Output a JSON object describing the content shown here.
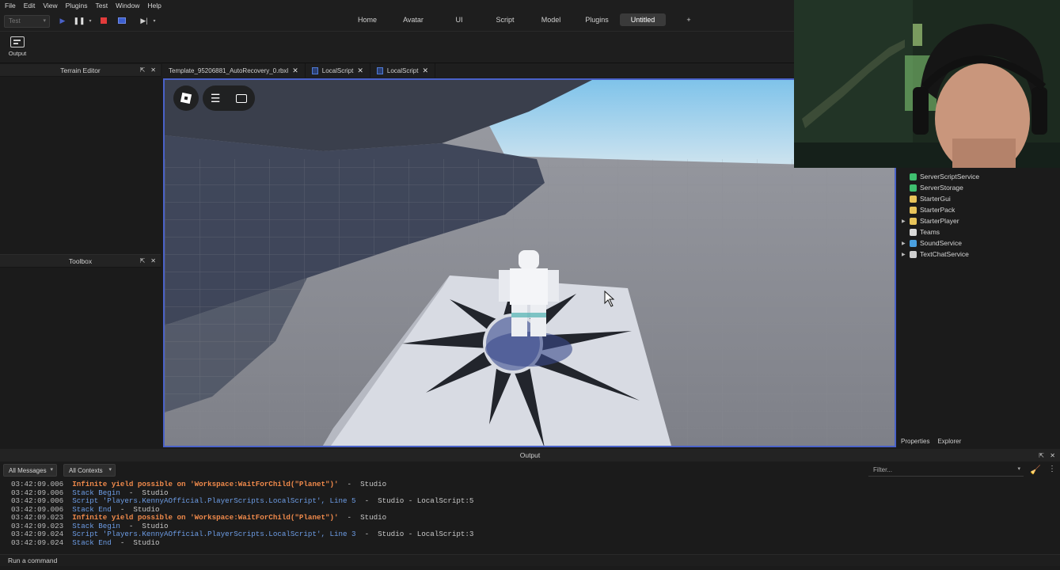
{
  "menu": [
    "File",
    "Edit",
    "View",
    "Plugins",
    "Test",
    "Window",
    "Help"
  ],
  "toolbar": {
    "mode_value": "Test"
  },
  "ribbon_tabs": [
    {
      "label": "Home"
    },
    {
      "label": "Avatar"
    },
    {
      "label": "UI"
    },
    {
      "label": "Script"
    },
    {
      "label": "Model"
    },
    {
      "label": "Plugins"
    },
    {
      "label": "Untitled",
      "active": true
    },
    {
      "label": "+"
    }
  ],
  "ribbon": {
    "output_label": "Output"
  },
  "panels": {
    "terrain_editor": "Terrain Editor",
    "toolbox": "Toolbox"
  },
  "doc_tabs": [
    {
      "label": "Template_95206881_AutoRecovery_0.rbxl"
    },
    {
      "label": "LocalScript"
    },
    {
      "label": "LocalScript"
    }
  ],
  "explorer": {
    "items": [
      {
        "label": "ServerScriptService",
        "icon": "server-script-icon",
        "color": "#3fbf6f",
        "expandable": false
      },
      {
        "label": "ServerStorage",
        "icon": "server-storage-icon",
        "color": "#3fbf6f",
        "expandable": false
      },
      {
        "label": "StarterGui",
        "icon": "folder-icon",
        "color": "#e8c45a",
        "expandable": false
      },
      {
        "label": "StarterPack",
        "icon": "folder-icon",
        "color": "#e8c45a",
        "expandable": false
      },
      {
        "label": "StarterPlayer",
        "icon": "folder-icon",
        "color": "#e8c45a",
        "expandable": true
      },
      {
        "label": "Teams",
        "icon": "teams-icon",
        "color": "#d9d9d9",
        "expandable": false
      },
      {
        "label": "SoundService",
        "icon": "sound-icon",
        "color": "#4aa0e0",
        "expandable": true
      },
      {
        "label": "TextChatService",
        "icon": "chat-icon",
        "color": "#cfcfcf",
        "expandable": true
      }
    ],
    "bottom_tabs": [
      "Properties",
      "Explorer"
    ]
  },
  "output": {
    "title": "Output",
    "messages_filter": "All Messages",
    "contexts_filter": "All Contexts",
    "filter_placeholder": "Filter...",
    "lines": [
      {
        "time": "03:42:09.006",
        "kind": "warn",
        "text": "Infinite yield possible on 'Workspace:WaitForChild(\"Planet\")'",
        "suffix": "  -  Studio"
      },
      {
        "time": "03:42:09.006",
        "kind": "info",
        "text": "Stack Begin",
        "suffix": "  -  Studio"
      },
      {
        "time": "03:42:09.006",
        "kind": "info",
        "text": "Script 'Players.KennyAOfficial.PlayerScripts.LocalScript', Line 5",
        "suffix": "  -  Studio - LocalScript:5"
      },
      {
        "time": "03:42:09.006",
        "kind": "info",
        "text": "Stack End",
        "suffix": "  -  Studio"
      },
      {
        "time": "03:42:09.023",
        "kind": "warn",
        "text": "Infinite yield possible on 'Workspace:WaitForChild(\"Planet\")'",
        "suffix": "  -  Studio"
      },
      {
        "time": "03:42:09.023",
        "kind": "info",
        "text": "Stack Begin",
        "suffix": "  -  Studio"
      },
      {
        "time": "03:42:09.024",
        "kind": "info",
        "text": "Script 'Players.KennyAOfficial.PlayerScripts.LocalScript', Line 3",
        "suffix": "  -  Studio - LocalScript:3"
      },
      {
        "time": "03:42:09.024",
        "kind": "info",
        "text": "Stack End",
        "suffix": "  -  Studio"
      }
    ],
    "command_placeholder": "Run a command"
  },
  "colors": {
    "viewport_border": "#4a62c9",
    "warn": "#f08a4b",
    "info": "#6d9de6"
  }
}
